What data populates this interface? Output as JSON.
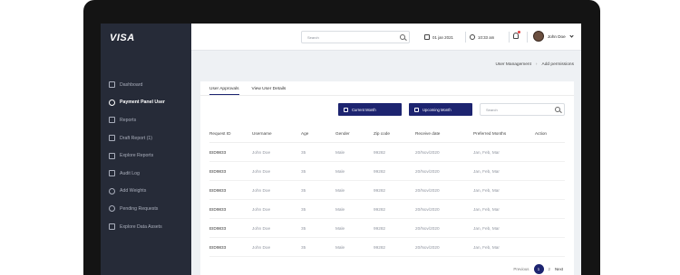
{
  "brand": {
    "logo": "VISA"
  },
  "sidebar": {
    "items": [
      {
        "label": "Dashboard",
        "active": false
      },
      {
        "label": "Payment Panel User",
        "active": true
      },
      {
        "label": "Reports",
        "active": false
      },
      {
        "label": "Draft Report (1)",
        "active": false
      },
      {
        "label": "Explore Reports",
        "active": false
      },
      {
        "label": "Audit Log",
        "active": false
      },
      {
        "label": "Add Weights",
        "active": false
      },
      {
        "label": "Pending Requests",
        "active": false
      },
      {
        "label": "Explore Data Assets",
        "active": false
      }
    ]
  },
  "topbar": {
    "search_placeholder": "Search",
    "date": "01 jan 2021",
    "time": "10:33 am",
    "user_name": "John Doe"
  },
  "breadcrumb": {
    "parent": "User Management",
    "separator": "›",
    "current": "Add permissions"
  },
  "tabs": [
    {
      "label": "User Approvals",
      "active": true
    },
    {
      "label": "View User Details",
      "active": false
    }
  ],
  "actions": {
    "current_month": "Current Month",
    "upcoming_month": "Upcoming Month",
    "search_placeholder": "Search"
  },
  "table": {
    "headers": [
      "Request ID",
      "Username",
      "Age",
      "Gender",
      "Zip code",
      "Receive date",
      "Preferred Months",
      "Action"
    ],
    "rows": [
      [
        "EID9833",
        "John Doe",
        "35",
        "Male",
        "99282",
        "20/Nov/2020",
        "Jan, Feb, Mar"
      ],
      [
        "EID9833",
        "John Doe",
        "35",
        "Male",
        "99282",
        "20/Nov/2020",
        "Jan, Feb, Mar"
      ],
      [
        "EID9833",
        "John Doe",
        "35",
        "Male",
        "99282",
        "20/Nov/2020",
        "Jan, Feb, Mar"
      ],
      [
        "EID9833",
        "John Doe",
        "35",
        "Male",
        "99282",
        "20/Nov/2020",
        "Jan, Feb, Mar"
      ],
      [
        "EID9833",
        "John Doe",
        "35",
        "Male",
        "99282",
        "20/Nov/2020",
        "Jan, Feb, Mar"
      ],
      [
        "EID9833",
        "John Doe",
        "35",
        "Male",
        "99282",
        "20/Nov/2020",
        "Jan, Feb, Mar"
      ]
    ]
  },
  "pagination": {
    "previous": "Previous",
    "pages": [
      "1",
      "2"
    ],
    "current": "1",
    "next": "Next"
  },
  "colors": {
    "accent": "#1d2470",
    "sidebar": "#262b38",
    "notification": "#e23c3c"
  }
}
